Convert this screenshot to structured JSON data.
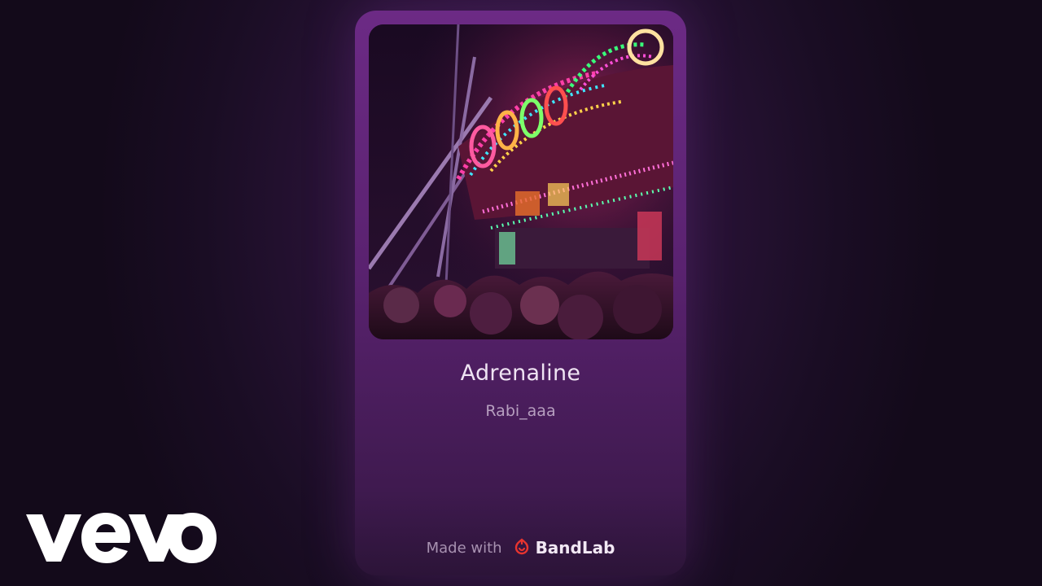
{
  "track": {
    "title": "Adrenaline",
    "artist": "Rabi_aaa"
  },
  "footer": {
    "made_with": "Made with",
    "brand": "BandLab"
  },
  "watermark": {
    "text": "vevo"
  },
  "icons": {
    "brand_icon": "bandlab-logo-icon"
  },
  "colors": {
    "card": "#5a2270",
    "brand_red": "#e8342f",
    "background": "#160b1e"
  }
}
